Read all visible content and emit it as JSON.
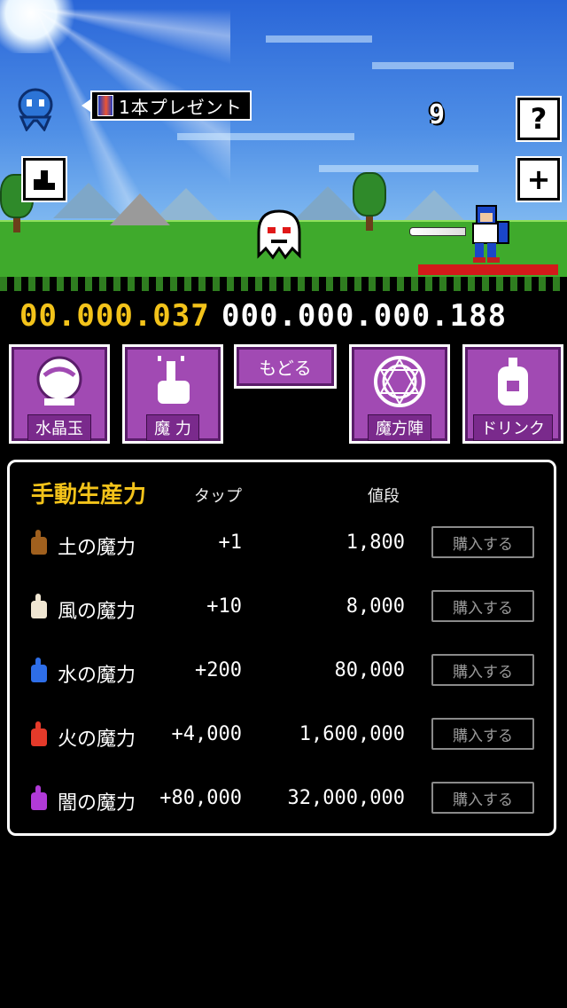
{
  "scene": {
    "gift_label": "1本プレゼント",
    "counter": "9",
    "help_button": "?",
    "plus_button": "+"
  },
  "stats": {
    "mana": "00.000.037",
    "score": "000.000.000.188"
  },
  "menu": {
    "items": [
      {
        "label": "水晶玉",
        "icon": "crystal-ball-icon"
      },
      {
        "label": "魔 力",
        "icon": "tap-hand-icon"
      },
      {
        "label": "魔方陣",
        "icon": "magic-circle-icon"
      },
      {
        "label": "ドリンク",
        "icon": "drink-bottle-icon"
      }
    ],
    "back_label": "もどる"
  },
  "panel": {
    "title": "手動生産力",
    "col_tap": "タップ",
    "col_price": "値段",
    "rows": [
      {
        "name": "土の魔力",
        "tap": "+1",
        "price": "1,800",
        "buy": "購入する",
        "color": "#a0601e"
      },
      {
        "name": "風の魔力",
        "tap": "+10",
        "price": "8,000",
        "buy": "購入する",
        "color": "#f0e6d2"
      },
      {
        "name": "水の魔力",
        "tap": "+200",
        "price": "80,000",
        "buy": "購入する",
        "color": "#2e6ee8"
      },
      {
        "name": "火の魔力",
        "tap": "+4,000",
        "price": "1,600,000",
        "buy": "購入する",
        "color": "#e53a2a"
      },
      {
        "name": "闇の魔力",
        "tap": "+80,000",
        "price": "32,000,000",
        "buy": "購入する",
        "color": "#b13ad8"
      }
    ]
  },
  "colors": {
    "accent_gold": "#f3c31a",
    "menu_purple": "#a14ab3",
    "hp_red": "#d21a1a"
  }
}
